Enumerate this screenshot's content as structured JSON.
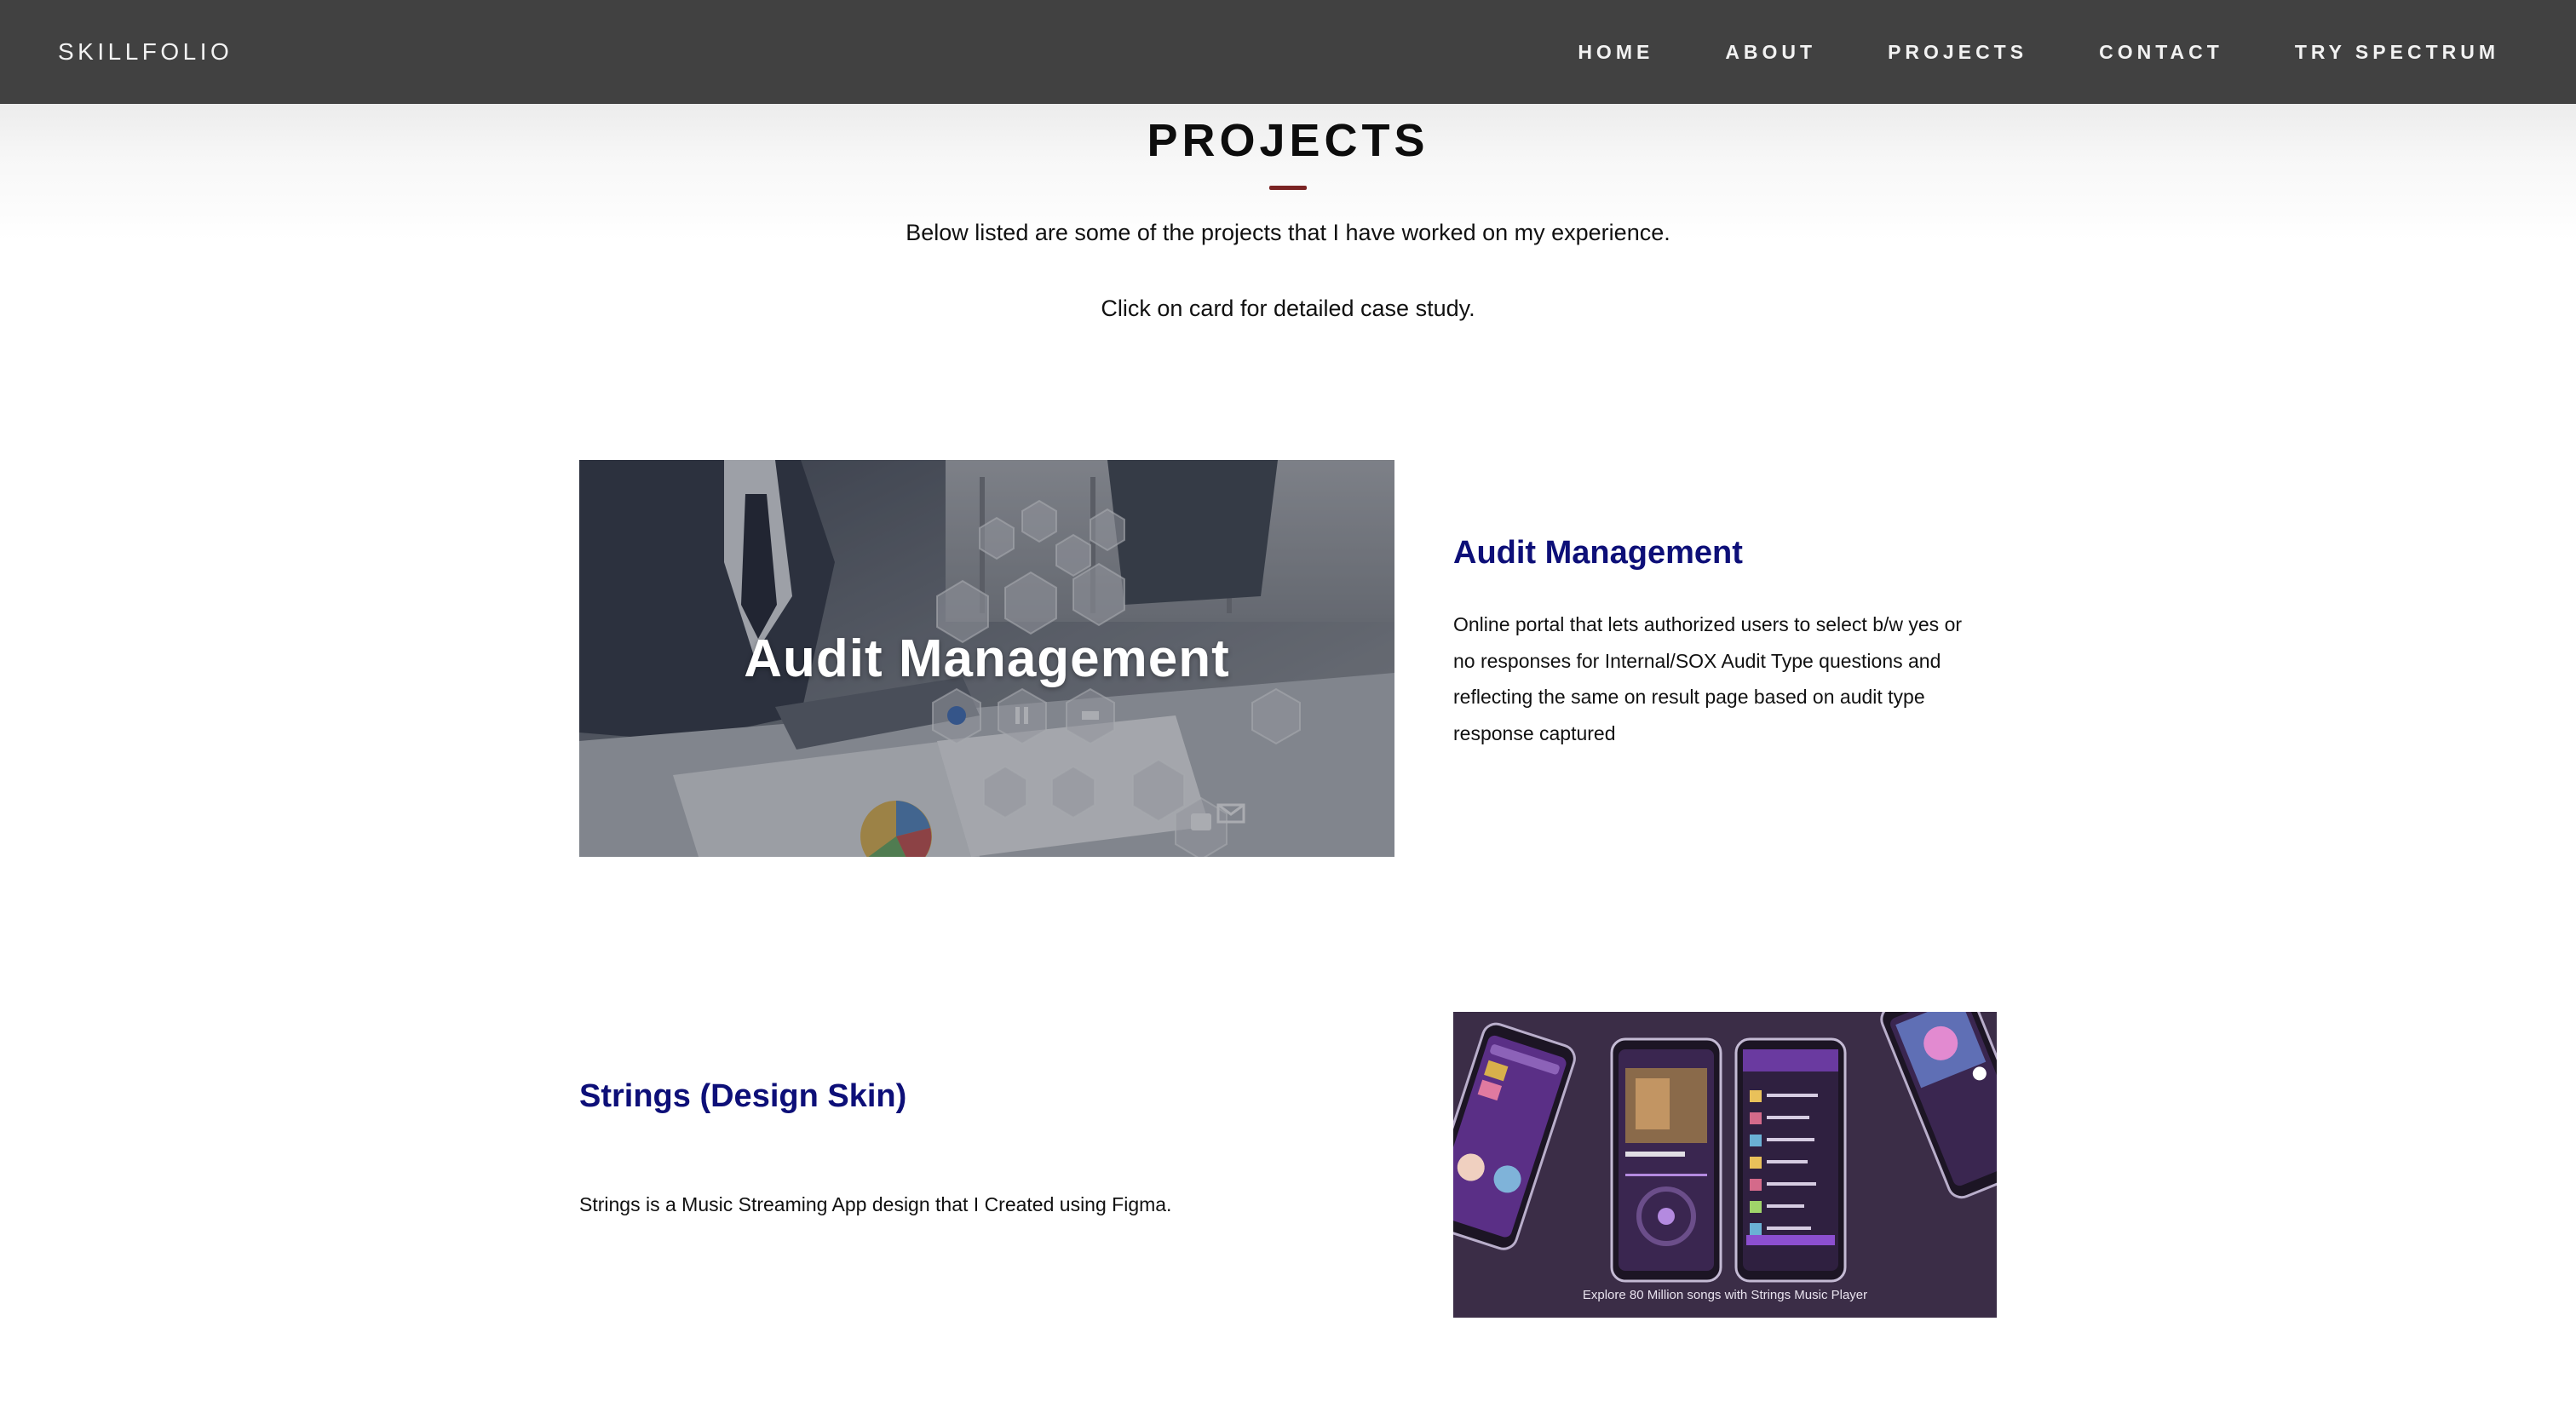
{
  "nav": {
    "brand": "SKILLFOLIO",
    "links": [
      "HOME",
      "ABOUT",
      "PROJECTS",
      "CONTACT",
      "TRY SPECTRUM"
    ]
  },
  "header": {
    "title": "PROJECTS",
    "intro_line_1": "Below listed are some of the projects that I have worked on my experience.",
    "intro_line_2": "Click on card for detailed case study."
  },
  "projects": [
    {
      "image_caption": "Audit Management",
      "title": "Audit Management",
      "description_lines": [
        "Online portal that lets authorized users to select b/w yes or",
        "no responses for Internal/SOX Audit Type questions and",
        "reflecting the same on result page based on audit type",
        "response captured"
      ]
    },
    {
      "title": "Strings (Design Skin)",
      "description": "Strings is a Music Streaming App design that I Created using Figma.",
      "image_caption": "Explore 80 Million songs with Strings Music Player"
    }
  ],
  "colors": {
    "navbar": "#414141",
    "project_title": "#0d0f78",
    "accent_underline": "#7a2323"
  }
}
